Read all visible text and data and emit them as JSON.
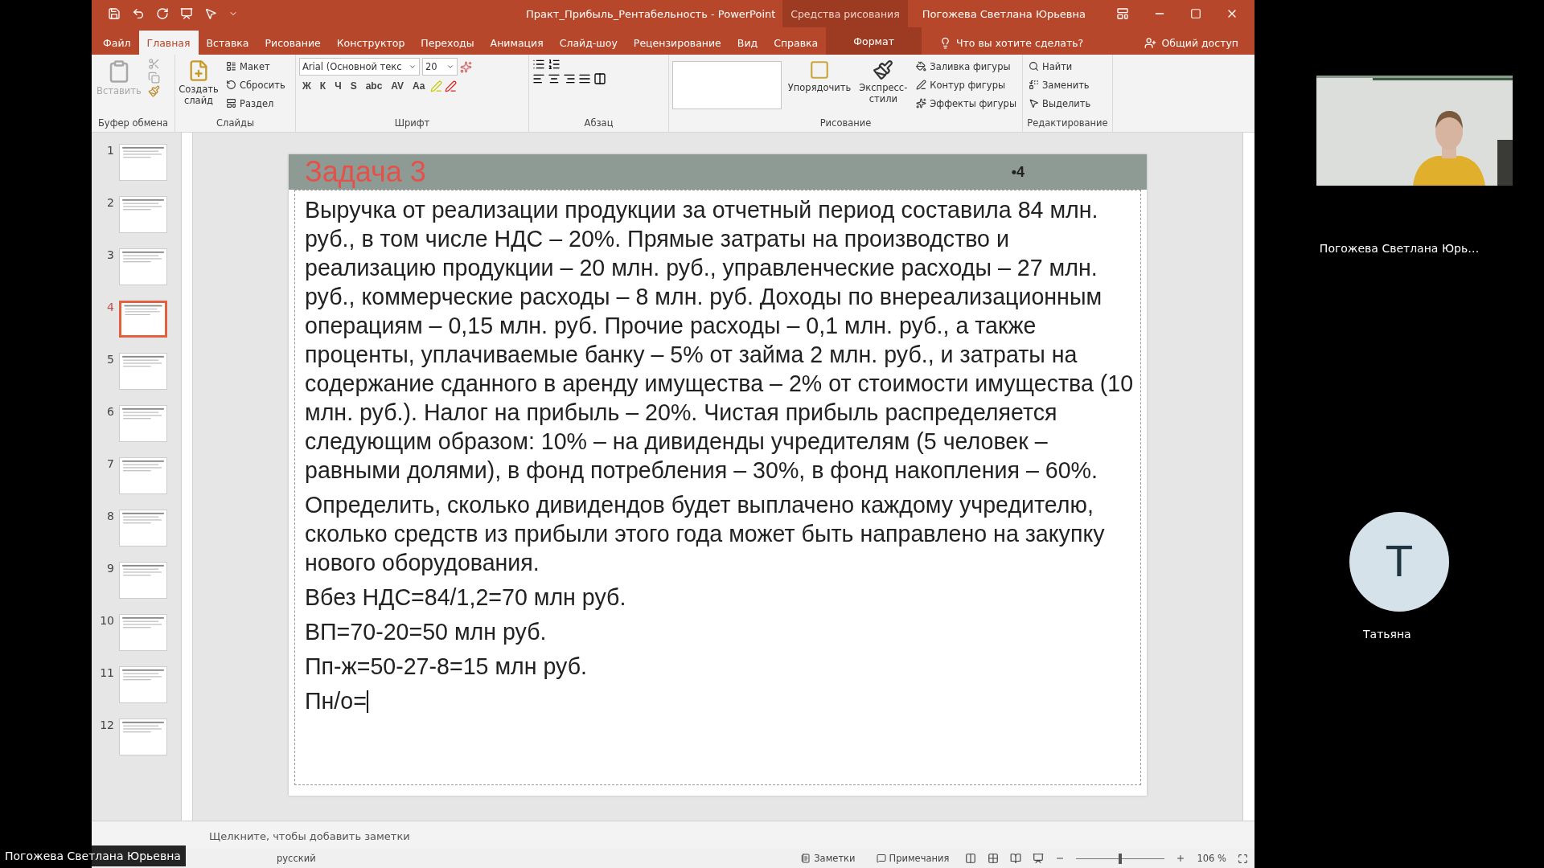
{
  "window": {
    "title": "Практ_Прибыль_Рентабельность  -  PowerPoint",
    "context_group": "Средства рисования",
    "user": "Погожева Светлана Юрьевна"
  },
  "tabs": [
    {
      "label": "Файл",
      "selected": false,
      "kind": "normal"
    },
    {
      "label": "Главная",
      "selected": true,
      "kind": "normal"
    },
    {
      "label": "Вставка",
      "selected": false,
      "kind": "normal"
    },
    {
      "label": "Рисование",
      "selected": false,
      "kind": "normal"
    },
    {
      "label": "Конструктор",
      "selected": false,
      "kind": "normal"
    },
    {
      "label": "Переходы",
      "selected": false,
      "kind": "normal"
    },
    {
      "label": "Анимация",
      "selected": false,
      "kind": "normal"
    },
    {
      "label": "Слайд-шоу",
      "selected": false,
      "kind": "normal"
    },
    {
      "label": "Рецензирование",
      "selected": false,
      "kind": "normal"
    },
    {
      "label": "Вид",
      "selected": false,
      "kind": "normal"
    },
    {
      "label": "Справка",
      "selected": false,
      "kind": "normal"
    },
    {
      "label": "Формат",
      "selected": false,
      "kind": "contextual"
    }
  ],
  "tell_me": "Что вы хотите сделать?",
  "share": "Общий доступ",
  "ribbon": {
    "clipboard": {
      "label": "Буфер обмена",
      "paste": "Вставить"
    },
    "slides": {
      "label": "Слайды",
      "new_slide": "Создать слайд",
      "items": [
        "Макет",
        "Сбросить",
        "Раздел"
      ]
    },
    "font": {
      "label": "Шрифт",
      "font_name": "Arial (Основной текс",
      "font_size": "20",
      "buttons": [
        "Ж",
        "К",
        "Ч",
        "S",
        "abc",
        "AV",
        "Aa"
      ]
    },
    "paragraph": {
      "label": "Абзац"
    },
    "drawing": {
      "label": "Рисование",
      "arrange": "Упорядочить",
      "styles": "Экспресс-стили",
      "items": [
        "Заливка фигуры",
        "Контур фигуры",
        "Эффекты фигуры"
      ]
    },
    "editing": {
      "label": "Редактирование",
      "items": [
        "Найти",
        "Заменить",
        "Выделить"
      ]
    }
  },
  "slides": [
    {
      "number": "1",
      "selected": false
    },
    {
      "number": "2",
      "selected": false
    },
    {
      "number": "3",
      "selected": false
    },
    {
      "number": "4",
      "selected": true
    },
    {
      "number": "5",
      "selected": false
    },
    {
      "number": "6",
      "selected": false
    },
    {
      "number": "7",
      "selected": false
    },
    {
      "number": "8",
      "selected": false
    },
    {
      "number": "9",
      "selected": false
    },
    {
      "number": "10",
      "selected": false
    },
    {
      "number": "11",
      "selected": false
    },
    {
      "number": "12",
      "selected": false
    }
  ],
  "slide": {
    "title": "Задача 3",
    "number": "•4",
    "paragraphs": [
      "Выручка от реализации продукции за отчетный период составила 84 млн. руб., в том числе НДС – 20%. Прямые затраты на производство и реализацию продукции – 20 млн. руб., управленческие расходы – 27 млн. руб., коммерческие расходы – 8 млн. руб. Доходы по внереализационным операциям – 0,15 млн. руб. Прочие расходы – 0,1 млн. руб., а также проценты, уплачиваемые банку – 5% от займа 2 млн. руб., и затраты на содержание сданного в аренду имущества – 2% от стоимости имущества (10 млн. руб.). Налог на прибыль – 20%. Чистая прибыль распределяется следующим образом: 10%  – на дивиденды учредителям (5 человек – равными долями), в фонд потребления – 30%, в фонд накопления – 60%.",
      "Определить, сколько дивидендов будет выплачено каждому учредителю, сколько средств из прибыли этого года может быть направлено на закупку нового оборудования.",
      "Вбез НДС=84/1,2=70 млн руб.",
      "ВП=70-20=50 млн руб.",
      "Пп-ж=50-27-8=15 млн руб.",
      "Пн/о="
    ]
  },
  "notes_placeholder": "Щелкните, чтобы добавить заметки",
  "status_bar": {
    "language": "русский",
    "notes": "Заметки",
    "comments": "Примечания",
    "zoom": "106 %",
    "zoom_slider": {
      "level": 0.5
    }
  },
  "meeting": {
    "participants": [
      {
        "kind": "video",
        "name": "Погожева Светлана Юрь…"
      },
      {
        "kind": "avatar",
        "initial": "Т",
        "name": "Татьяна"
      }
    ],
    "presenter_label": "Погожева Светлана Юрьевна"
  }
}
